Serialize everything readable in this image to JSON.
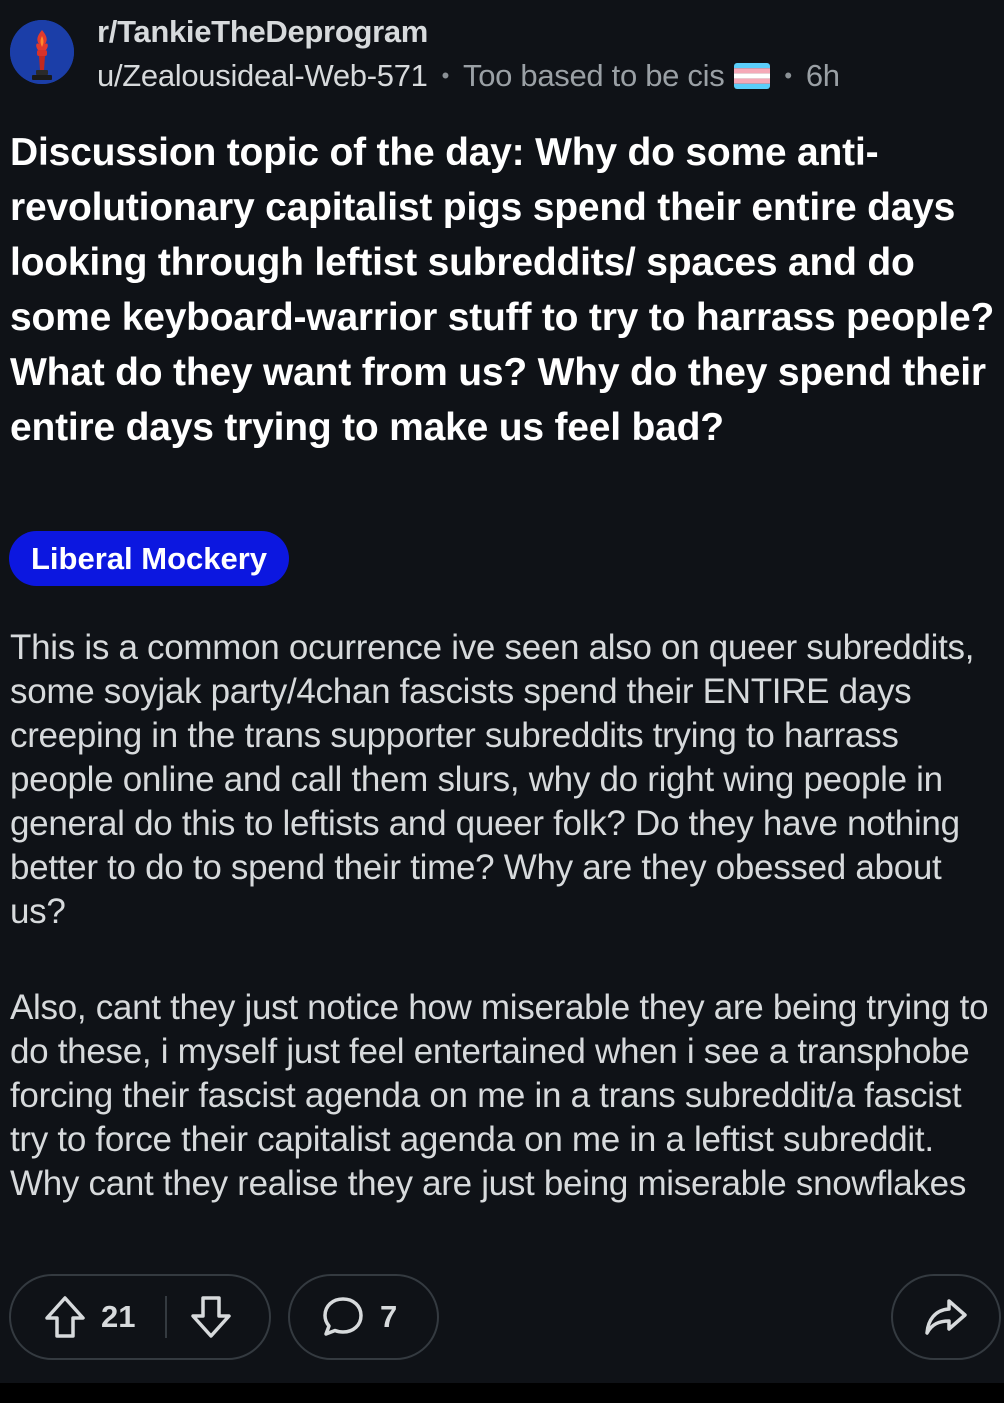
{
  "header": {
    "subreddit": "r/TankieTheDeprogram",
    "username": "u/Zealousideal-Web-571",
    "user_flair": "Too based to be cis",
    "flair_emoji": "transgender-flag",
    "separator": "•",
    "time_ago": "6h"
  },
  "post": {
    "title": "Discussion topic of the day: Why do some anti-revolutionary capitalist pigs spend their entire days looking through leftist subreddits/ spaces and do some keyboard-warrior stuff to try to harrass people? What do they want from us? Why do they spend their entire days trying to make us feel bad?",
    "flair": "Liberal Mockery",
    "flair_color": "#0c17e0",
    "body_paragraphs": [
      "This is a common ocurrence ive seen also on queer subreddits, some soyjak party/4chan fascists spend their ENTIRE days creeping in the trans supporter subreddits trying to harrass people online and call them slurs, why do right wing people in general do this to leftists and queer folk? Do they have nothing better to do to spend their time? Why are they obessed about us?",
      "Also, cant they just notice how miserable they are being trying to do these, i myself just feel entertained when i see a transphobe forcing their fascist agenda on me in a trans subreddit/a fascist try to force their capitalist agenda on me in a leftist subreddit. Why cant they realise they are just being miserable snowflakes"
    ]
  },
  "actions": {
    "upvote_icon": "arrow-up-icon",
    "score": "21",
    "downvote_icon": "arrow-down-icon",
    "comment_icon": "speech-bubble-icon",
    "comment_count": "7",
    "share_icon": "share-arrow-icon"
  },
  "colors": {
    "background": "#0f1217",
    "text": "#d7dadc",
    "title": "#ffffff",
    "muted": "#9aa0a5",
    "pill_border": "#343a40"
  }
}
